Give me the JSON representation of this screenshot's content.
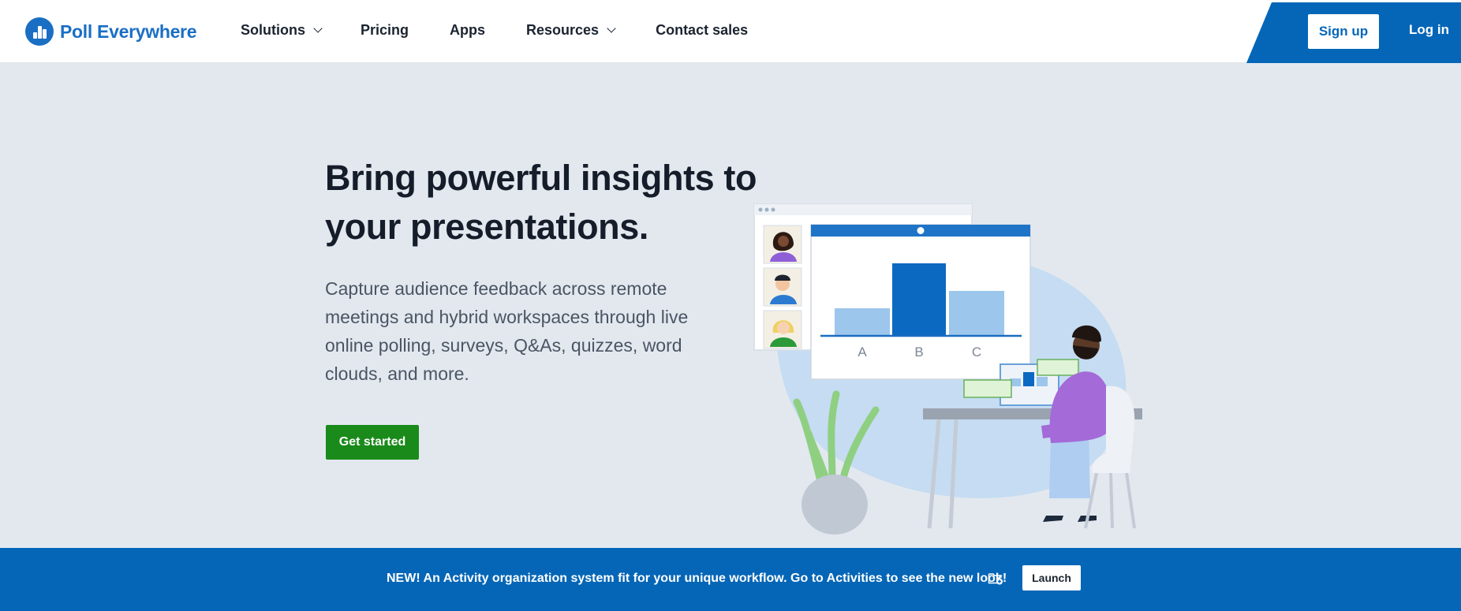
{
  "brand": {
    "name": "Poll Everywhere",
    "color": "#1a6fc4"
  },
  "nav": {
    "items": [
      {
        "label": "Solutions",
        "has_dropdown": true
      },
      {
        "label": "Pricing",
        "has_dropdown": false
      },
      {
        "label": "Apps",
        "has_dropdown": false
      },
      {
        "label": "Resources",
        "has_dropdown": true
      },
      {
        "label": "Contact sales",
        "has_dropdown": false
      }
    ],
    "signup": "Sign up",
    "login": "Log in"
  },
  "hero": {
    "title": "Bring powerful insights to your presentations.",
    "description": "Capture audience feedback across remote meetings and hybrid workspaces through live online polling, surveys, Q&As, quizzes, word clouds, and more.",
    "cta": "Get started"
  },
  "illustration": {
    "chart_labels": [
      "A",
      "B",
      "C"
    ]
  },
  "banner": {
    "text": "NEW! An Activity organization system fit for your unique workflow. Go to Activities to see the new look!",
    "launch": "Launch",
    "icon": "folder-plus-icon"
  },
  "colors": {
    "primary_blue": "#0566b7",
    "cta_green": "#1a8a1a",
    "hero_bg": "#e3e8ef"
  }
}
